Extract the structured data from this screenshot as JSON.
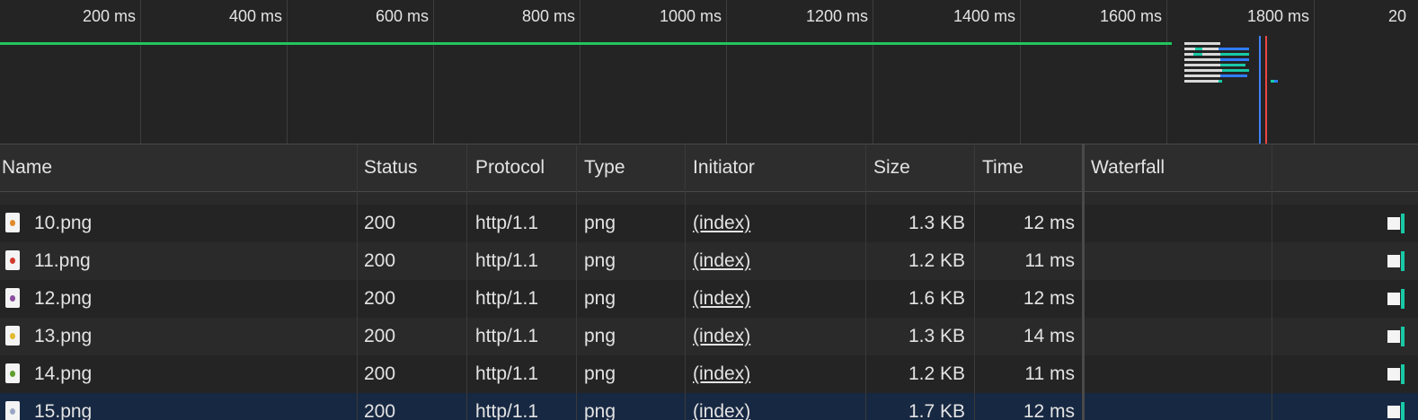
{
  "timeline": {
    "ticks": [
      "200 ms",
      "400 ms",
      "600 ms",
      "800 ms",
      "1000 ms",
      "1200 ms",
      "1400 ms",
      "1600 ms",
      "1800 ms",
      "20"
    ],
    "colors": {
      "primary_bar": "#22c55e",
      "request_wait": "#d9d9d9",
      "request_download": "#19c9a6",
      "request_blue": "#2f7dff",
      "dom_content_loaded": "#3b82f6",
      "load_event": "#ef4444"
    }
  },
  "columns": {
    "name": "Name",
    "status": "Status",
    "protocol": "Protocol",
    "type": "Type",
    "initiator": "Initiator",
    "size": "Size",
    "time": "Time",
    "waterfall": "Waterfall"
  },
  "rows": [
    {
      "name": "10.png",
      "status": "200",
      "protocol": "http/1.1",
      "type": "png",
      "initiator": "(index)",
      "size": "1.3 KB",
      "time": "12 ms",
      "icon": "carrot-image-icon",
      "icon_color": "#e08a2a"
    },
    {
      "name": "11.png",
      "status": "200",
      "protocol": "http/1.1",
      "type": "png",
      "initiator": "(index)",
      "size": "1.2 KB",
      "time": "11 ms",
      "icon": "chili-image-icon",
      "icon_color": "#d23b2b"
    },
    {
      "name": "12.png",
      "status": "200",
      "protocol": "http/1.1",
      "type": "png",
      "initiator": "(index)",
      "size": "1.6 KB",
      "time": "12 ms",
      "icon": "grapes-image-icon",
      "icon_color": "#8a4d9e"
    },
    {
      "name": "13.png",
      "status": "200",
      "protocol": "http/1.1",
      "type": "png",
      "initiator": "(index)",
      "size": "1.3 KB",
      "time": "14 ms",
      "icon": "banana-image-icon",
      "icon_color": "#e2b92c"
    },
    {
      "name": "14.png",
      "status": "200",
      "protocol": "http/1.1",
      "type": "png",
      "initiator": "(index)",
      "size": "1.2 KB",
      "time": "11 ms",
      "icon": "leaf-image-icon",
      "icon_color": "#5e9e2d"
    },
    {
      "name": "15.png",
      "status": "200",
      "protocol": "http/1.1",
      "type": "png",
      "initiator": "(index)",
      "size": "1.7 KB",
      "time": "12 ms",
      "icon": "flower-image-icon",
      "icon_color": "#9aa7c4",
      "selected": true
    }
  ]
}
